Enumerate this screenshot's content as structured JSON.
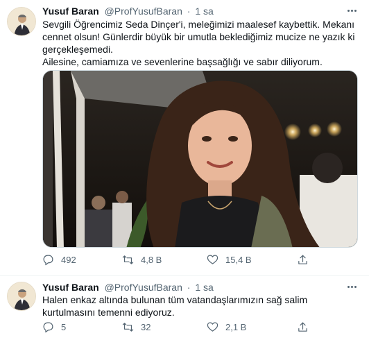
{
  "tweets": [
    {
      "author_name": "Yusuf Baran",
      "handle": "@ProfYusufBaran",
      "separator": "·",
      "time": "1 sa",
      "text_lines": [
        "Sevgili Öğrencimiz Seda Dinçer'i, meleğimizi maalesef kaybettik. Mekanı cennet olsun! Günlerdir büyük bir umutla beklediğimiz mucize ne yazık ki gerçekleşemedi.",
        "Ailesine, camiamıza ve sevenlerine başsağlığı ve sabır diliyorum."
      ],
      "media": "photo",
      "replies": "492",
      "retweets": "4,8 B",
      "likes": "15,4 B"
    },
    {
      "author_name": "Yusuf Baran",
      "handle": "@ProfYusufBaran",
      "separator": "·",
      "time": "1 sa",
      "text_lines": [
        "Halen enkaz altında bulunan tüm vatandaşlarımızın sağ salim kurtulmasını temenni ediyoruz."
      ],
      "replies": "5",
      "retweets": "32",
      "likes": "2,1 B"
    }
  ],
  "icons": {
    "reply": "reply-icon",
    "retweet": "retweet-icon",
    "like": "heart-icon",
    "share": "share-icon",
    "more": "more-icon"
  },
  "colors": {
    "text": "#0f1419",
    "secondary": "#536471",
    "divider": "#eff3f4"
  }
}
